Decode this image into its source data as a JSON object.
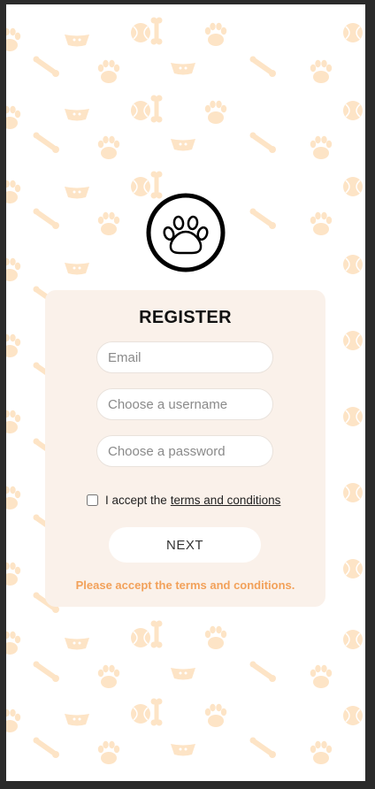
{
  "colors": {
    "page_bg": "#ffffff",
    "frame_border": "#2b2b2b",
    "pattern": "#fde4c6",
    "card_bg": "#faf1ea",
    "error_text": "#f2a15a"
  },
  "logo": {
    "icon": "paw-icon"
  },
  "form": {
    "title": "REGISTER",
    "email_placeholder": "Email",
    "username_placeholder": "Choose a username",
    "password_placeholder": "Choose a password",
    "terms_prefix": "I accept the",
    "terms_link": "terms and conditions",
    "terms_checked": false,
    "next_label": "NEXT",
    "error_message": "Please accept the terms and conditions."
  },
  "background_icons": [
    "paw-icon",
    "bone-icon",
    "ball-icon",
    "toy-icon",
    "bowl-icon"
  ]
}
